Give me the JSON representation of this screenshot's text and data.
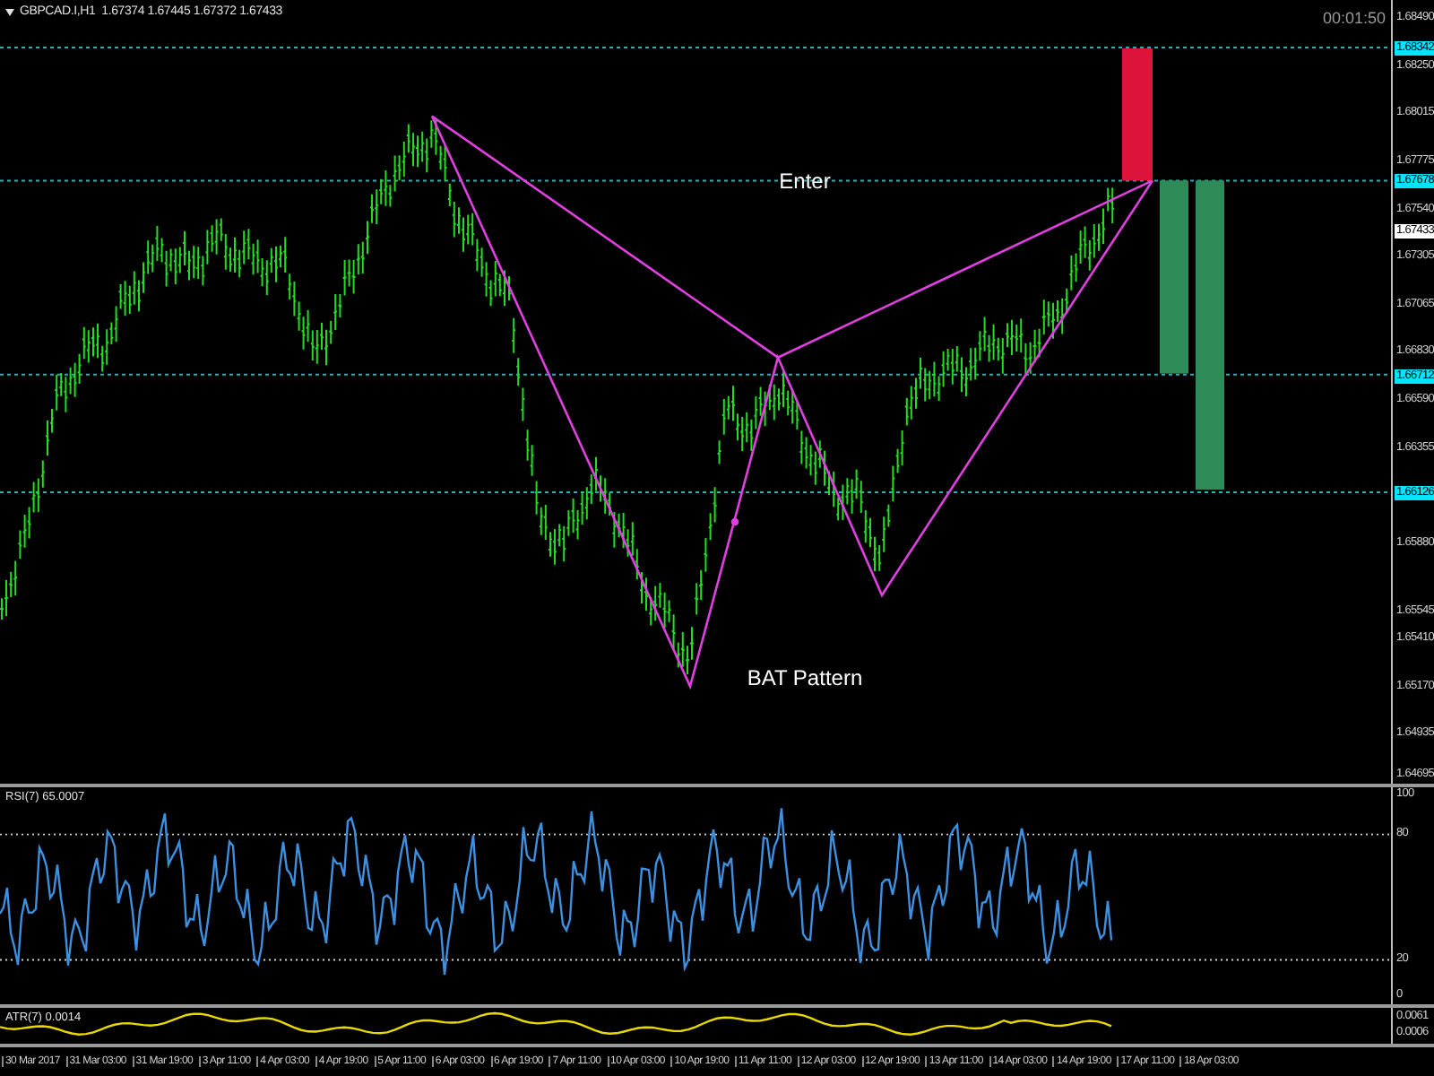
{
  "header": {
    "symbol_info": "GBPCAD.I,H1  1.67374 1.67445 1.67372 1.67433",
    "timer": "00:01:50"
  },
  "price_axis": [
    {
      "label": "1.68490",
      "kind": "tick"
    },
    {
      "label": "1.68342",
      "kind": "level"
    },
    {
      "label": "1.68250",
      "kind": "tick"
    },
    {
      "label": "1.68015",
      "kind": "tick"
    },
    {
      "label": "1.67775",
      "kind": "tick"
    },
    {
      "label": "1.67678",
      "kind": "level"
    },
    {
      "label": "1.67540",
      "kind": "tick"
    },
    {
      "label": "1.67433",
      "kind": "current"
    },
    {
      "label": "1.67305",
      "kind": "tick"
    },
    {
      "label": "1.67065",
      "kind": "tick"
    },
    {
      "label": "1.66830",
      "kind": "tick"
    },
    {
      "label": "1.66712",
      "kind": "level"
    },
    {
      "label": "1.66590",
      "kind": "tick"
    },
    {
      "label": "1.66355",
      "kind": "tick"
    },
    {
      "label": "1.66126",
      "kind": "level"
    },
    {
      "label": "1.65880",
      "kind": "tick"
    },
    {
      "label": "1.65545",
      "kind": "tick"
    },
    {
      "label": "1.65410",
      "kind": "tick"
    },
    {
      "label": "1.65170",
      "kind": "tick"
    },
    {
      "label": "1.64935",
      "kind": "tick"
    },
    {
      "label": "1.64695",
      "kind": "tick"
    }
  ],
  "annotations": [
    {
      "text": "Enter"
    },
    {
      "text": "BAT Pattern"
    }
  ],
  "rsi": {
    "label": "RSI(7) 65.0007",
    "axis": [
      "100",
      "80",
      "20",
      "0"
    ]
  },
  "atr": {
    "label": "ATR(7) 0.0014",
    "axis": [
      "0.0061",
      "0.0006"
    ]
  },
  "time_axis": [
    "30 Mar 2017",
    "31 Mar 03:00",
    "31 Mar 19:00",
    "3 Apr 11:00",
    "4 Apr 03:00",
    "4 Apr 19:00",
    "5 Apr 11:00",
    "6 Apr 03:00",
    "6 Apr 19:00",
    "7 Apr 11:00",
    "10 Apr 03:00",
    "10 Apr 19:00",
    "11 Apr 11:00",
    "12 Apr 03:00",
    "12 Apr 19:00",
    "13 Apr 11:00",
    "14 Apr 03:00",
    "14 Apr 19:00",
    "17 Apr 11:00",
    "18 Apr 03:00"
  ]
}
